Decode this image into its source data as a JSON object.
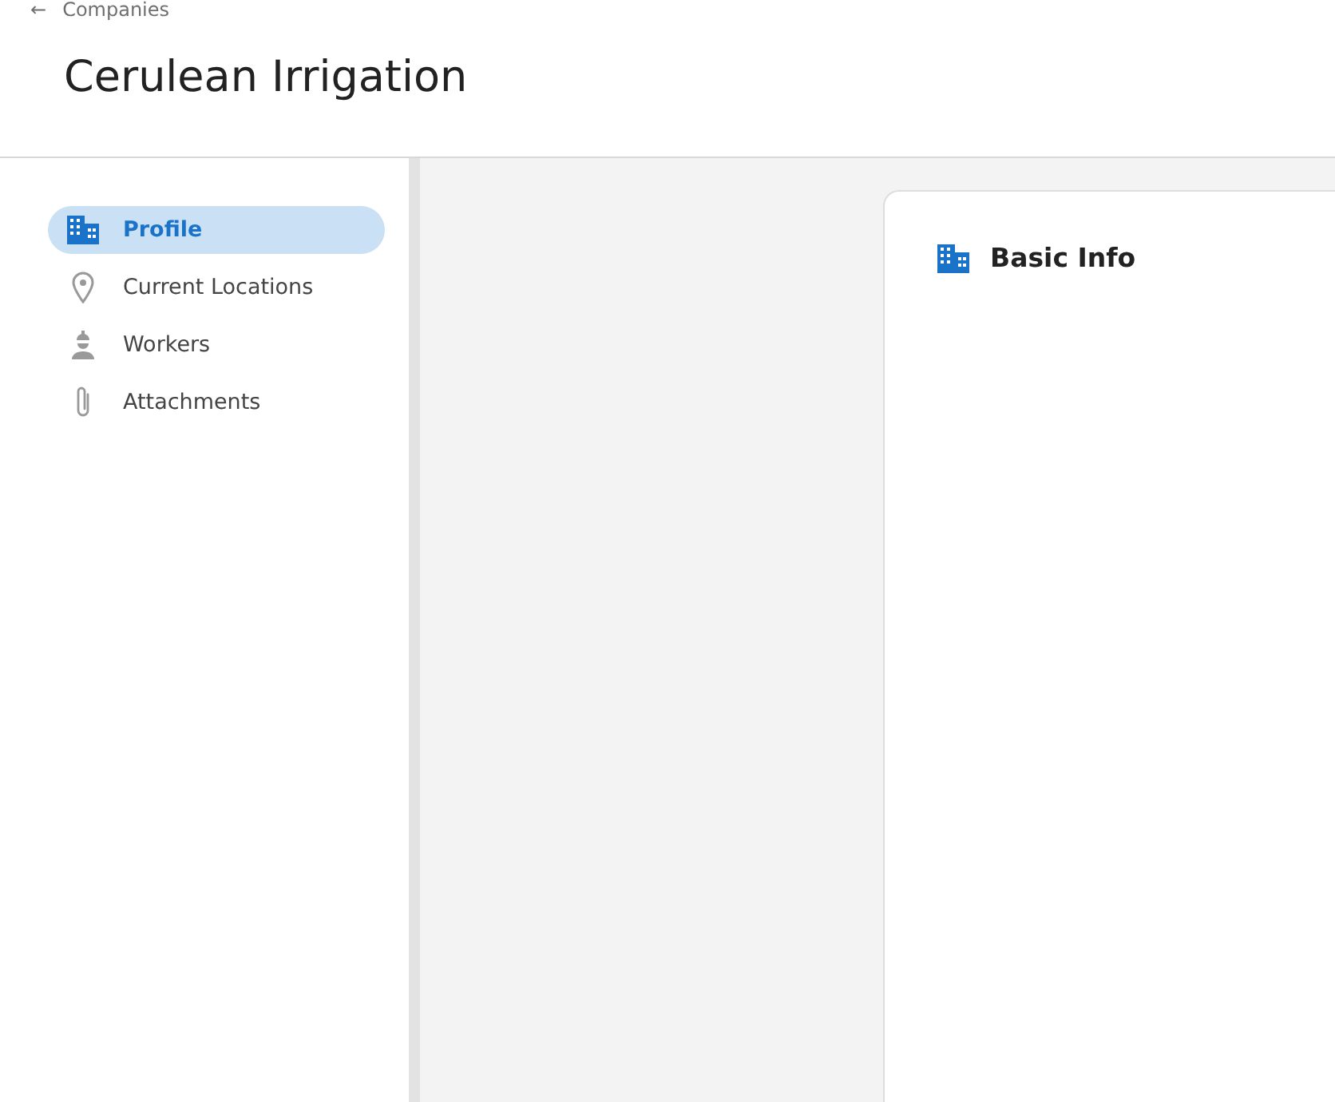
{
  "breadcrumb": {
    "icon": "←",
    "label": "Companies"
  },
  "title": "Cerulean Irrigation",
  "sidebar": {
    "items": [
      {
        "label": "Profile",
        "kind": "building",
        "selected": true
      },
      {
        "label": "Current Locations",
        "kind": "pin",
        "selected": false
      },
      {
        "label": "Workers",
        "kind": "worker",
        "selected": false
      },
      {
        "label": "Attachments",
        "kind": "clip",
        "selected": false
      }
    ]
  },
  "card": {
    "title": "Basic Info",
    "kind": "building"
  }
}
